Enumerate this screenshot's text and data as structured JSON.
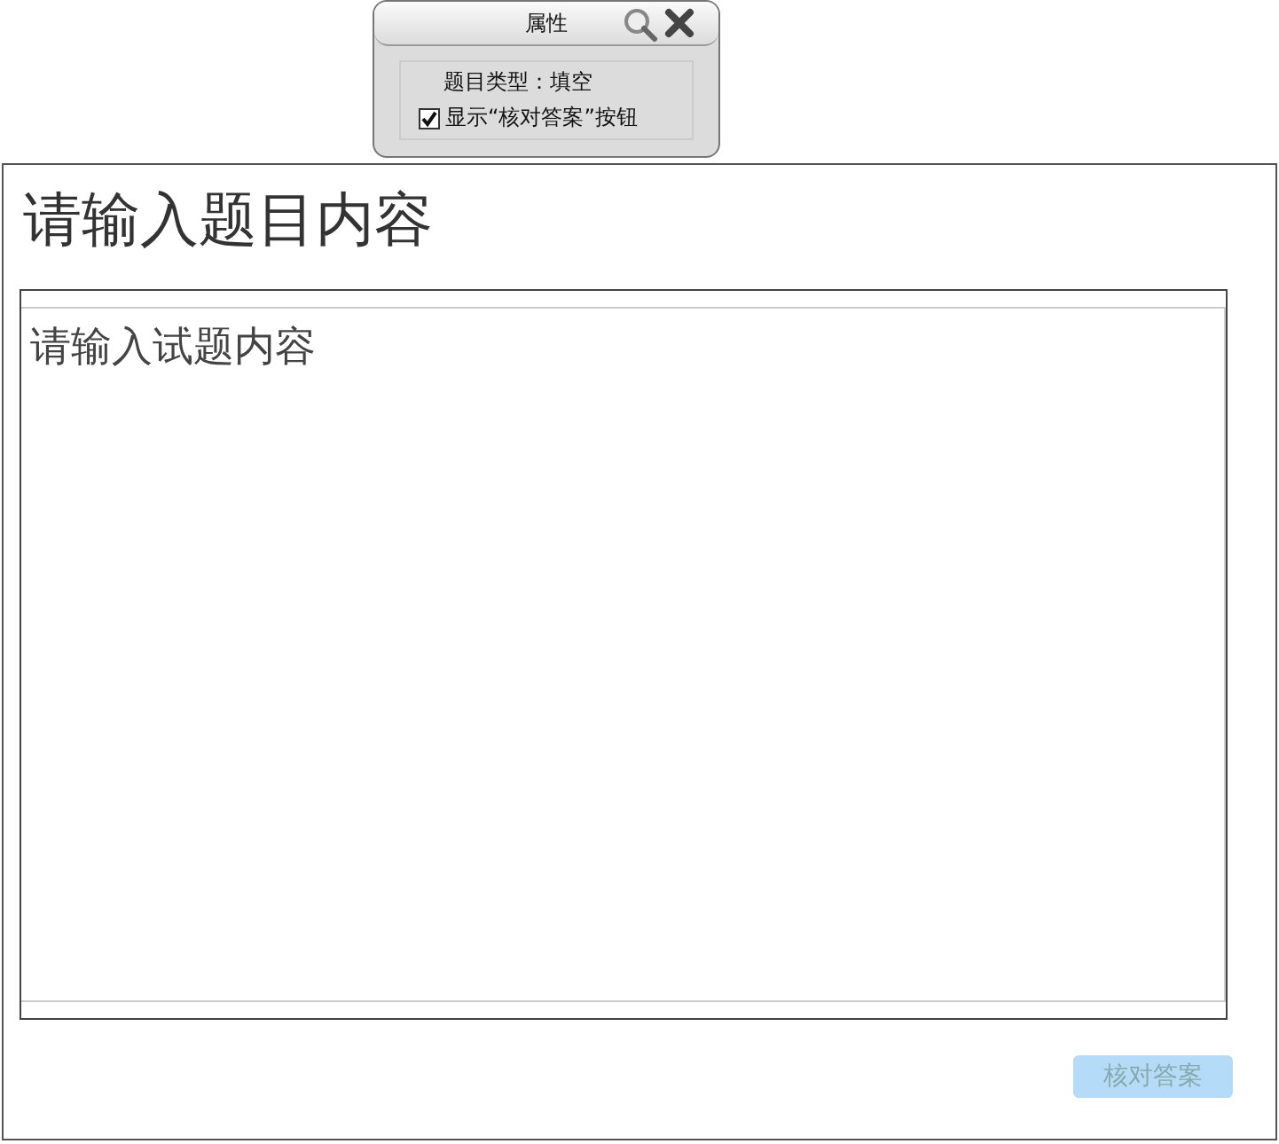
{
  "properties_panel": {
    "title": "属性",
    "question_type": "题目类型：填空",
    "show_check_button": {
      "label": "显示“核对答案”按钮",
      "checked": true
    }
  },
  "question": {
    "title": "请输入题目内容",
    "content_placeholder": "请输入试题内容"
  },
  "check_button": {
    "label": "核对答案",
    "disabled": true
  }
}
